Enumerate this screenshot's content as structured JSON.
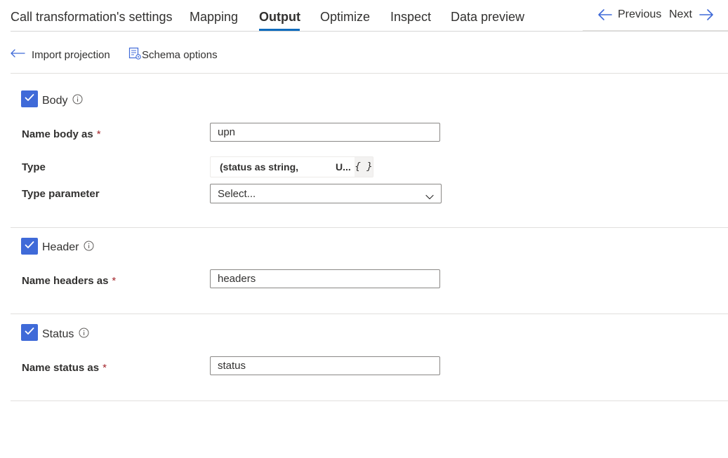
{
  "tabs": [
    {
      "label": "Call transformation's settings"
    },
    {
      "label": "Mapping"
    },
    {
      "label": "Output"
    },
    {
      "label": "Optimize"
    },
    {
      "label": "Inspect"
    },
    {
      "label": "Data preview"
    }
  ],
  "active_tab": "Output",
  "nav": {
    "previous": "Previous",
    "next": "Next"
  },
  "toolbar": {
    "import_projection": "Import projection",
    "schema_options": "Schema options"
  },
  "sections": {
    "body": {
      "title": "Body",
      "checked": true,
      "name_label": "Name body as",
      "required_mark": "*",
      "name_value": "upn",
      "type_label": "Type",
      "type_value": "(status as string,",
      "type_truncated": "U...",
      "type_icon": "{ }",
      "type_param_label": "Type parameter",
      "type_param_value": "Select..."
    },
    "header": {
      "title": "Header",
      "checked": true,
      "name_label": "Name headers as",
      "required_mark": "*",
      "name_value": "headers"
    },
    "status": {
      "title": "Status",
      "checked": true,
      "name_label": "Name status as",
      "required_mark": "*",
      "name_value": "status"
    }
  },
  "colors": {
    "accent": "#3f6ad8",
    "tab_underline": "#0f6cbd",
    "required": "#a4262c"
  },
  "icons": [
    "arrow-left-icon",
    "arrow-right-icon",
    "import-icon",
    "schema-icon",
    "checkmark-icon",
    "info-icon",
    "chevron-down-icon",
    "braces-icon"
  ]
}
